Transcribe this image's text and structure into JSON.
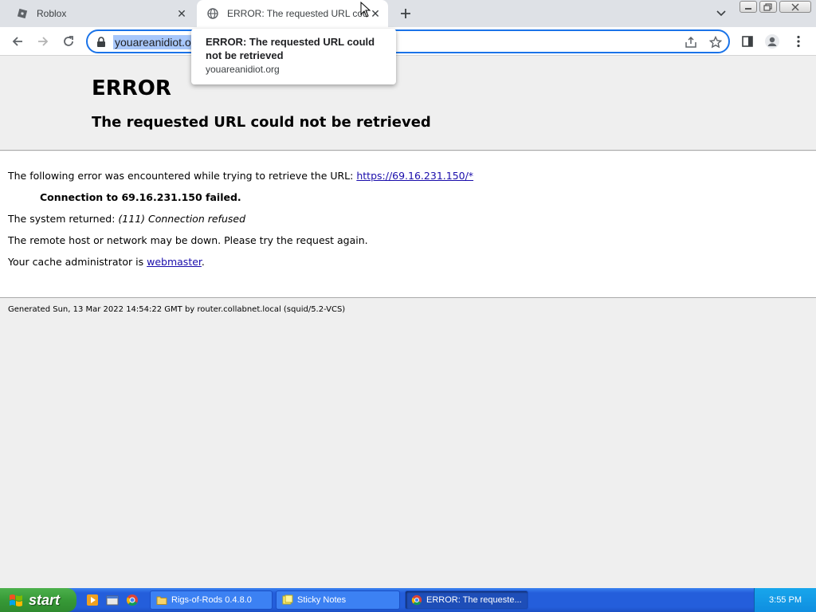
{
  "browser": {
    "tabs": [
      {
        "title": "Roblox",
        "active": false
      },
      {
        "title": "ERROR: The requested URL could",
        "active": true
      }
    ],
    "address_bar": {
      "url": "youareanidiot.org"
    },
    "hovercard": {
      "title": "ERROR: The requested URL could not be retrieved",
      "domain": "youareanidiot.org"
    }
  },
  "page": {
    "heading": "ERROR",
    "subheading": "The requested URL could not be retrieved",
    "line1_prefix": "The following error was encountered while trying to retrieve the URL: ",
    "line1_link": "https://69.16.231.150/*",
    "line2": "Connection to 69.16.231.150 failed.",
    "line3_prefix": "The system returned: ",
    "line3_value": "(111) Connection refused",
    "line4": "The remote host or network may be down. Please try the request again.",
    "line5_prefix": "Your cache administrator is ",
    "line5_link": "webmaster",
    "line5_suffix": ".",
    "footer": "Generated Sun, 13 Mar 2022 14:54:22 GMT by router.collabnet.local (squid/5.2-VCS)"
  },
  "taskbar": {
    "start_label": "start",
    "buttons": [
      {
        "label": "Rigs-of-Rods 0.4.8.0",
        "icon": "folder-icon"
      },
      {
        "label": "Sticky Notes",
        "icon": "sticky-notes-icon"
      },
      {
        "label": "ERROR: The requeste...",
        "icon": "chrome-icon",
        "active": true
      }
    ],
    "clock": "3:55 PM"
  },
  "colors": {
    "accent": "#1a73e8",
    "link": "#1a0dab",
    "taskbar": "#245edb",
    "start": "#379a37"
  }
}
